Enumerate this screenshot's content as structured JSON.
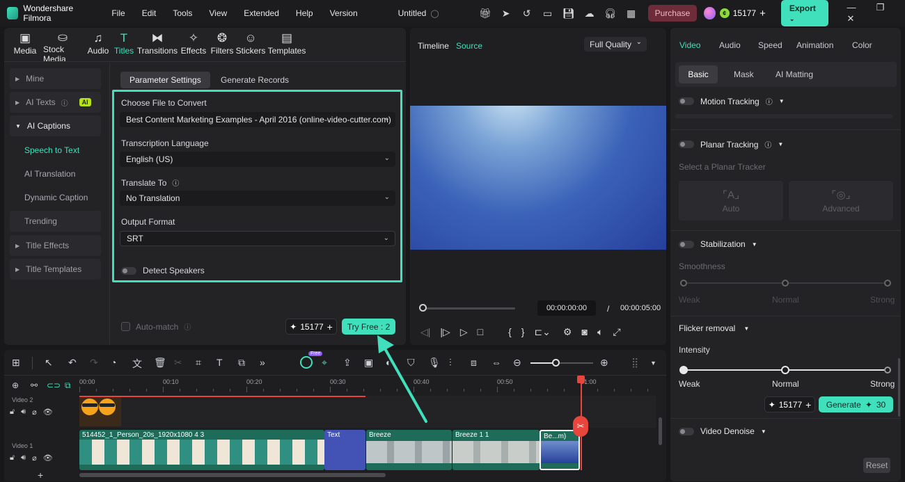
{
  "app": {
    "name": "Wondershare Filmora",
    "project_title": "Untitled"
  },
  "menu": [
    "File",
    "Edit",
    "Tools",
    "View",
    "Extended",
    "Help",
    "Version"
  ],
  "titlebar": {
    "purchase_label": "Purchase",
    "credits": "15177",
    "export_label": "Export"
  },
  "toolbar": [
    {
      "label": "Media",
      "icon": "media-icon"
    },
    {
      "label": "Stock Media",
      "icon": "stock-media-icon"
    },
    {
      "label": "Audio",
      "icon": "music-note-icon"
    },
    {
      "label": "Titles",
      "icon": "titles-icon"
    },
    {
      "label": "Transitions",
      "icon": "transitions-icon"
    },
    {
      "label": "Effects",
      "icon": "effects-icon"
    },
    {
      "label": "Filters",
      "icon": "filters-icon"
    },
    {
      "label": "Stickers",
      "icon": "stickers-icon"
    },
    {
      "label": "Templates",
      "icon": "templates-icon"
    }
  ],
  "sidebar": {
    "mine": "Mine",
    "ai_texts": "AI Texts",
    "ai_badge": "AI",
    "ai_captions": "AI Captions",
    "speech_to_text": "Speech to Text",
    "ai_translation": "AI Translation",
    "dynamic_caption": "Dynamic Caption",
    "trending": "Trending",
    "title_effects": "Title Effects",
    "title_templates": "Title Templates"
  },
  "stt": {
    "tab_params": "Parameter Settings",
    "tab_records": "Generate Records",
    "file_label": "Choose File to Convert",
    "file_value": "Best Content Marketing Examples - April 2016 (online-video-cutter.com)",
    "lang_label": "Transcription Language",
    "lang_value": "English (US)",
    "translate_label": "Translate To",
    "translate_value": "No Translation",
    "format_label": "Output Format",
    "format_value": "SRT",
    "detect_speakers": "Detect Speakers",
    "auto_match": "Auto-match",
    "credits": "15177",
    "try_free": "Try Free : 2"
  },
  "preview": {
    "tab_timeline": "Timeline",
    "tab_source": "Source",
    "quality": "Full Quality",
    "current_time": "00:00:00:00",
    "separator": "/",
    "total_time": "00:00:05:00"
  },
  "right_panel": {
    "tabs": [
      "Video",
      "Audio",
      "Speed",
      "Animation",
      "Color"
    ],
    "subtabs": [
      "Basic",
      "Mask",
      "AI Matting"
    ],
    "motion_tracking": "Motion Tracking",
    "planar_tracking": "Planar Tracking",
    "select_tracker": "Select a Planar Tracker",
    "auto": "Auto",
    "advanced": "Advanced",
    "stabilization": "Stabilization",
    "smoothness": "Smoothness",
    "weak": "Weak",
    "normal": "Normal",
    "strong": "Strong",
    "flicker_removal": "Flicker removal",
    "intensity": "Intensity",
    "credits": "15177",
    "generate": "Generate",
    "generate_cost": "30",
    "video_denoise": "Video Denoise",
    "reset": "Reset"
  },
  "timeline": {
    "ruler": [
      "00:00",
      "00:10",
      "00:20",
      "00:30",
      "00:40",
      "00:50",
      "01:00"
    ],
    "track2": "Video 2",
    "track1": "Video 1",
    "clip_main": "514452_1_Person_20s_1920x1080 4 3",
    "clip_text": "Text",
    "clip_breeze": "Breeze",
    "clip_breeze2": "Breeze 1 1",
    "clip_last": "Be...m)",
    "free_badge": "Free",
    "zoom_level": 0.4
  },
  "colors": {
    "accent": "#3fe0bb",
    "purchase_bg": "#6e2c3a",
    "playhead": "#e8453c"
  }
}
